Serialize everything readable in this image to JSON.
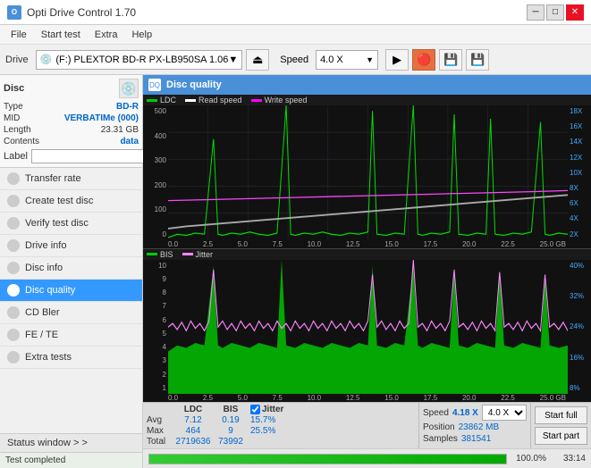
{
  "app": {
    "title": "Opti Drive Control 1.70",
    "icon_text": "O"
  },
  "titlebar": {
    "title": "Opti Drive Control 1.70",
    "minimize": "─",
    "maximize": "□",
    "close": "✕"
  },
  "menubar": {
    "items": [
      "File",
      "Start test",
      "Extra",
      "Help"
    ]
  },
  "toolbar": {
    "drive_label": "Drive",
    "drive_name": "(F:)  PLEXTOR BD-R  PX-LB950SA 1.06",
    "speed_label": "Speed",
    "speed_value": "4.0 X"
  },
  "disc": {
    "title": "Disc",
    "type_label": "Type",
    "type_val": "BD-R",
    "mid_label": "MID",
    "mid_val": "VERBATIMe (000)",
    "length_label": "Length",
    "length_val": "23.31 GB",
    "contents_label": "Contents",
    "contents_val": "data",
    "label_label": "Label"
  },
  "sidebar": {
    "items": [
      {
        "id": "transfer-rate",
        "label": "Transfer rate",
        "active": false
      },
      {
        "id": "create-test-disc",
        "label": "Create test disc",
        "active": false
      },
      {
        "id": "verify-test-disc",
        "label": "Verify test disc",
        "active": false
      },
      {
        "id": "drive-info",
        "label": "Drive info",
        "active": false
      },
      {
        "id": "disc-info",
        "label": "Disc info",
        "active": false
      },
      {
        "id": "disc-quality",
        "label": "Disc quality",
        "active": true
      },
      {
        "id": "cd-bler",
        "label": "CD Bler",
        "active": false
      },
      {
        "id": "fe-te",
        "label": "FE / TE",
        "active": false
      },
      {
        "id": "extra-tests",
        "label": "Extra tests",
        "active": false
      }
    ]
  },
  "status_window": {
    "label": "Status window > >"
  },
  "disc_quality": {
    "title": "Disc quality"
  },
  "chart_top": {
    "legend": [
      {
        "label": "LDC",
        "color": "#00cc00"
      },
      {
        "label": "Read speed",
        "color": "#ffffff"
      },
      {
        "label": "Write speed",
        "color": "#ff00ff"
      }
    ],
    "y_axis_left": [
      "500",
      "400",
      "300",
      "200",
      "100",
      "0"
    ],
    "y_axis_right": [
      "18X",
      "16X",
      "14X",
      "12X",
      "10X",
      "8X",
      "6X",
      "4X",
      "2X"
    ],
    "x_axis": [
      "0.0",
      "2.5",
      "5.0",
      "7.5",
      "10.0",
      "12.5",
      "15.0",
      "17.5",
      "20.0",
      "22.5",
      "25.0 GB"
    ]
  },
  "chart_bot": {
    "legend": [
      {
        "label": "BIS",
        "color": "#00cc00"
      },
      {
        "label": "Jitter",
        "color": "#ff88ff"
      }
    ],
    "y_axis_left": [
      "10",
      "9",
      "8",
      "7",
      "6",
      "5",
      "4",
      "3",
      "2",
      "1"
    ],
    "y_axis_right": [
      "40%",
      "32%",
      "24%",
      "16%",
      "8%"
    ],
    "x_axis": [
      "0.0",
      "2.5",
      "5.0",
      "7.5",
      "10.0",
      "12.5",
      "15.0",
      "17.5",
      "20.0",
      "22.5",
      "25.0 GB"
    ]
  },
  "stats": {
    "ldc_label": "LDC",
    "bis_label": "BIS",
    "jitter_label": "Jitter",
    "jitter_checked": true,
    "speed_label": "Speed",
    "speed_val": "4.18 X",
    "speed_select": "4.0 X",
    "position_label": "Position",
    "position_val": "23862 MB",
    "samples_label": "Samples",
    "samples_val": "381541",
    "avg_label": "Avg",
    "avg_ldc": "7.12",
    "avg_bis": "0.19",
    "avg_jitter": "15.7%",
    "max_label": "Max",
    "max_ldc": "464",
    "max_bis": "9",
    "max_jitter": "25.5%",
    "total_label": "Total",
    "total_ldc": "2719636",
    "total_bis": "73992",
    "btn_start_full": "Start full",
    "btn_start_part": "Start part"
  },
  "progress": {
    "pct": "100.0%",
    "fill_pct": 100,
    "time": "33:14"
  },
  "status": {
    "text": "Test completed"
  }
}
